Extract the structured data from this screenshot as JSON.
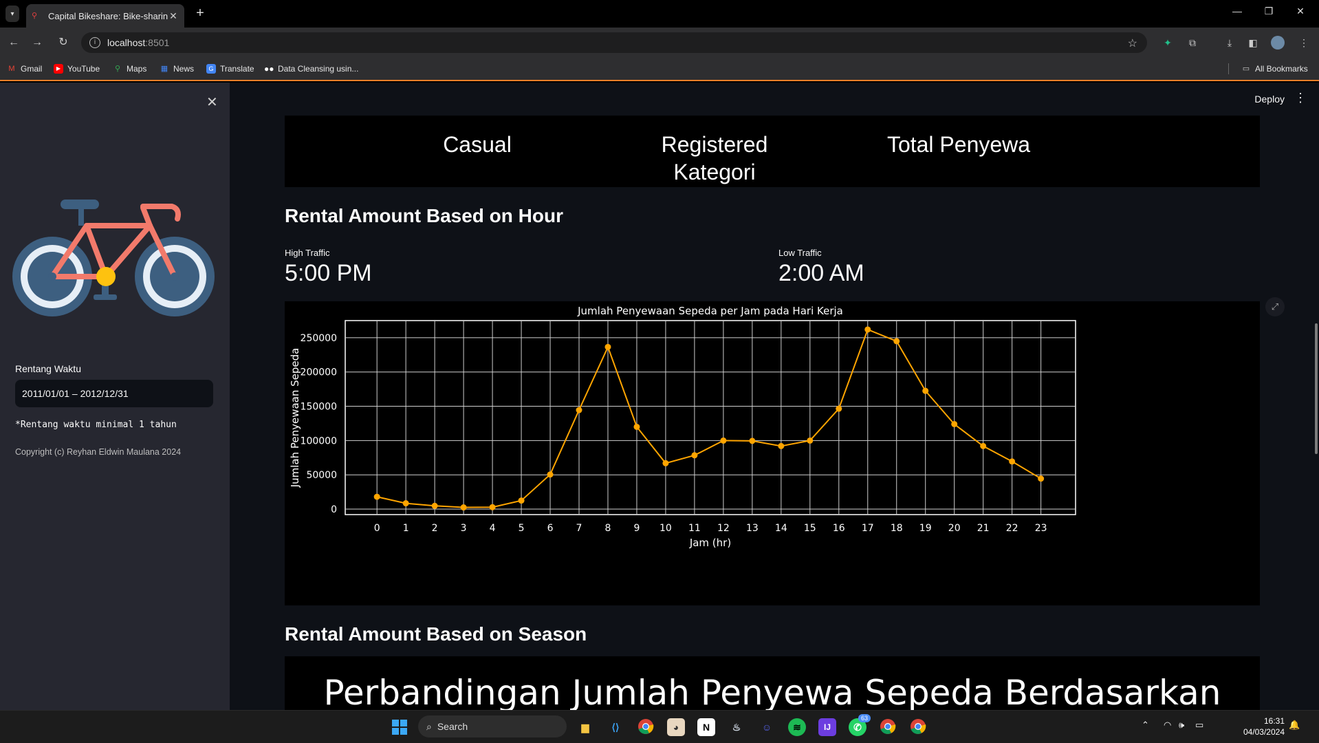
{
  "browser": {
    "tab_title": "Capital Bikeshare: Bike-sharing",
    "url_host": "localhost",
    "url_port": ":8501",
    "bookmarks": [
      {
        "label": "Gmail",
        "icon": "gmail-icon",
        "color": "#ea4335"
      },
      {
        "label": "YouTube",
        "icon": "youtube-icon",
        "color": "#ff0000"
      },
      {
        "label": "Maps",
        "icon": "maps-icon",
        "color": "#34a853"
      },
      {
        "label": "News",
        "icon": "news-icon",
        "color": "#4285f4"
      },
      {
        "label": "Translate",
        "icon": "translate-icon",
        "color": "#4285f4"
      },
      {
        "label": "Data Cleansing usin...",
        "icon": "medium-icon",
        "color": "#ffffff"
      }
    ],
    "all_bookmarks": "All Bookmarks"
  },
  "sidebar": {
    "date_label": "Rentang Waktu",
    "date_value": "2011/01/01 – 2012/12/31",
    "note": "*Rentang waktu minimal 1 tahun",
    "copyright": "Copyright (c) Reyhan Eldwin Maulana 2024"
  },
  "header": {
    "deploy": "Deploy"
  },
  "main": {
    "table_headers": [
      "Casual",
      "Registered",
      "Total Penyewa"
    ],
    "table_subheader": "Kategori",
    "hour_heading": "Rental Amount Based on Hour",
    "metrics": [
      {
        "label": "High Traffic",
        "value": "5:00 PM"
      },
      {
        "label": "Low Traffic",
        "value": "2:00 AM"
      }
    ],
    "season_heading": "Rental Amount Based on Season",
    "season_chart_title": "Perbandingan Jumlah Penyewa Sepeda Berdasarkan Musim"
  },
  "chart_data": {
    "type": "line",
    "title": "Jumlah Penyewaan Sepeda per Jam pada Hari Kerja",
    "xlabel": "Jam (hr)",
    "ylabel": "Jumlah Penyewaan Sepeda",
    "x": [
      0,
      1,
      2,
      3,
      4,
      5,
      6,
      7,
      8,
      9,
      10,
      11,
      12,
      13,
      14,
      15,
      16,
      17,
      18,
      19,
      20,
      21,
      22,
      23
    ],
    "y": [
      18000,
      8500,
      4800,
      2500,
      2800,
      12500,
      50500,
      144500,
      236500,
      120000,
      67000,
      78500,
      100000,
      99500,
      92000,
      100000,
      146500,
      262000,
      245000,
      172500,
      124000,
      92000,
      69500,
      44500
    ],
    "ylim": [
      -8000,
      275000
    ],
    "yticks": [
      0,
      50000,
      100000,
      150000,
      200000,
      250000
    ],
    "grid": true,
    "line_color": "#ffa500"
  },
  "taskbar": {
    "search": "Search",
    "time": "16:31",
    "date": "04/03/2024",
    "badge_whatsapp": "63"
  }
}
